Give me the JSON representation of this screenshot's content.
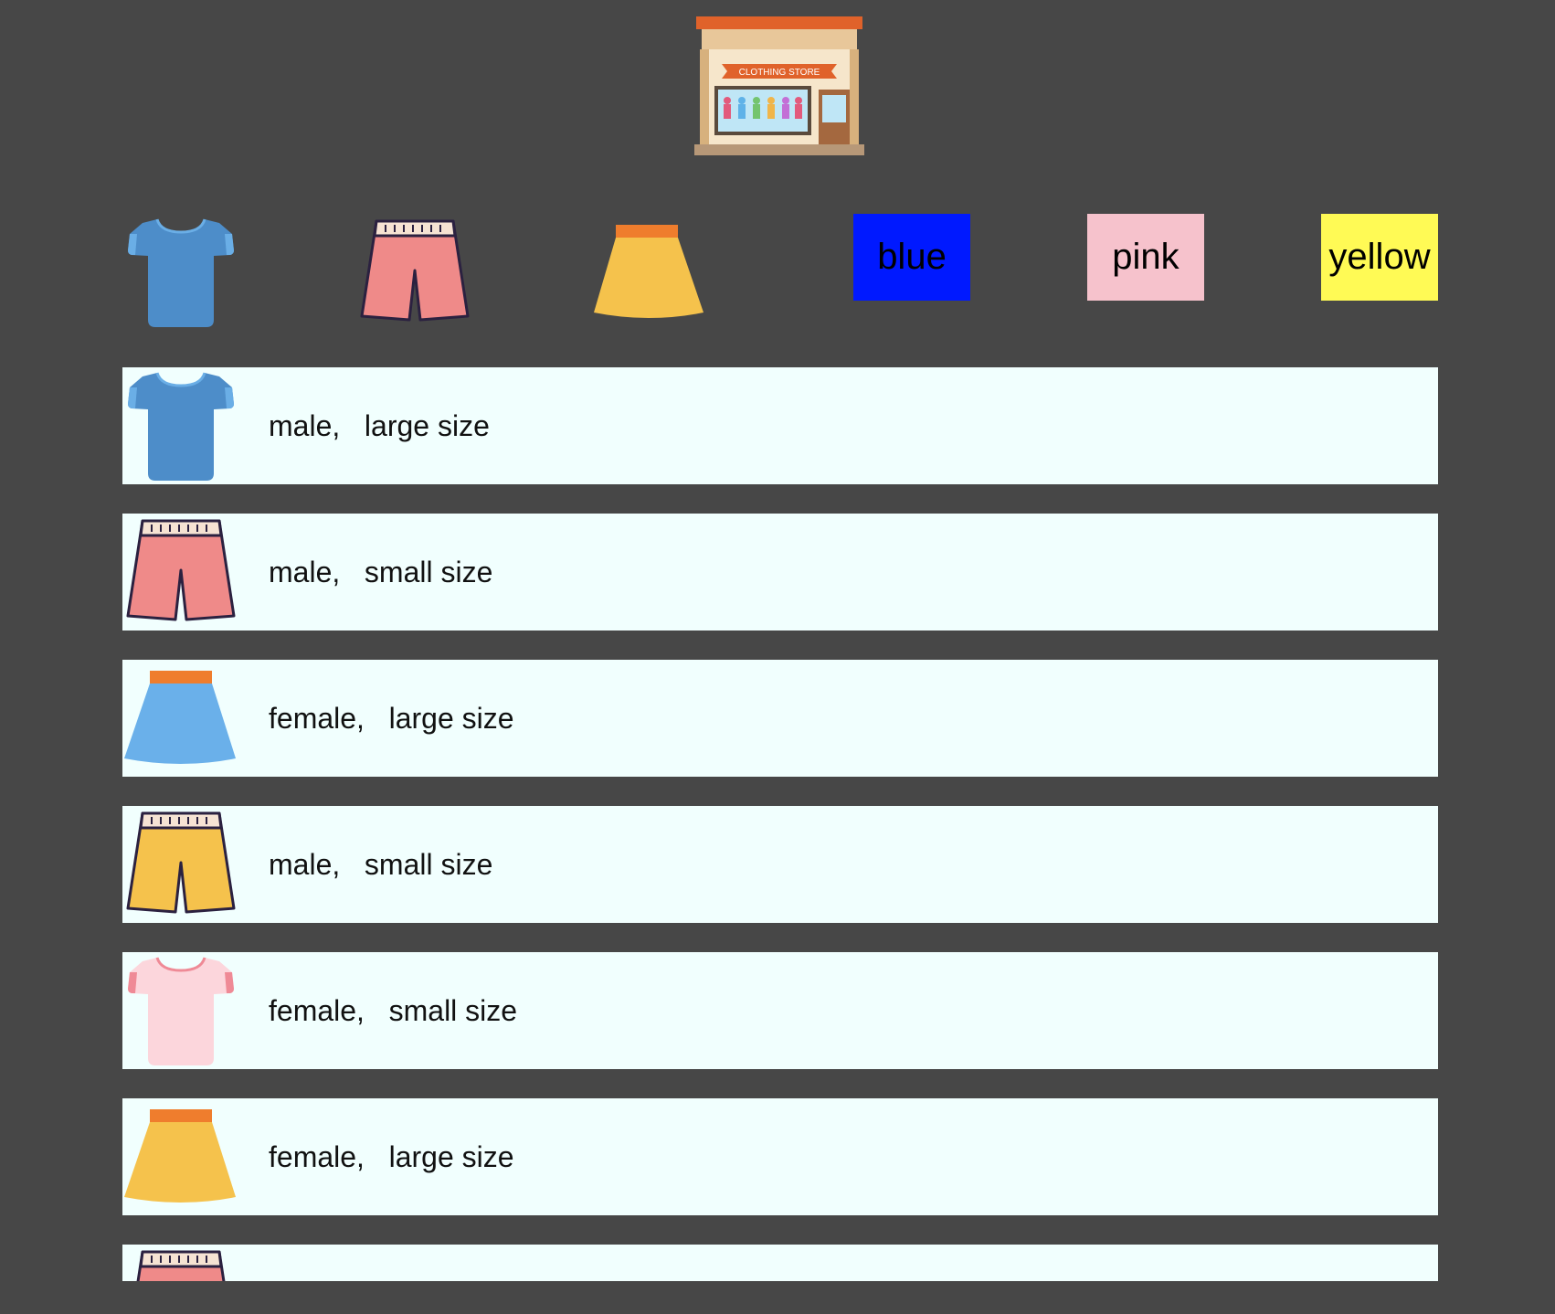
{
  "store": {
    "icon": "clothing-store-icon",
    "sign_text": "CLOTHING STORE"
  },
  "filters": {
    "types": [
      {
        "name": "tshirt",
        "icon": "tshirt-icon",
        "color": "#4d8dc9"
      },
      {
        "name": "shorts",
        "icon": "shorts-icon",
        "color": "#ef8a89"
      },
      {
        "name": "skirt",
        "icon": "skirt-icon",
        "color": "#f5c24c"
      }
    ],
    "colors": [
      {
        "label": "blue",
        "hex": "#0019ff"
      },
      {
        "label": "pink",
        "hex": "#f6c2cc"
      },
      {
        "label": "yellow",
        "hex": "#fffa55"
      }
    ]
  },
  "items": [
    {
      "icon": "tshirt-icon",
      "item_color": "#4d8dc9",
      "gender": "male,",
      "size": "large size"
    },
    {
      "icon": "shorts-icon",
      "item_color": "#ef8a89",
      "gender": "male,",
      "size": "small size"
    },
    {
      "icon": "skirt-icon",
      "item_color": "#6ab0ea",
      "gender": "female,",
      "size": "large size"
    },
    {
      "icon": "shorts-icon",
      "item_color": "#f5c24c",
      "gender": "male,",
      "size": "small size"
    },
    {
      "icon": "tshirt-icon",
      "item_color": "#fcd6dc",
      "gender": "female,",
      "size": "small size"
    },
    {
      "icon": "skirt-icon",
      "item_color": "#f5c24c",
      "gender": "female,",
      "size": "large size"
    },
    {
      "icon": "shorts-icon",
      "item_color": "#ef8a89",
      "gender": "",
      "size": ""
    }
  ]
}
